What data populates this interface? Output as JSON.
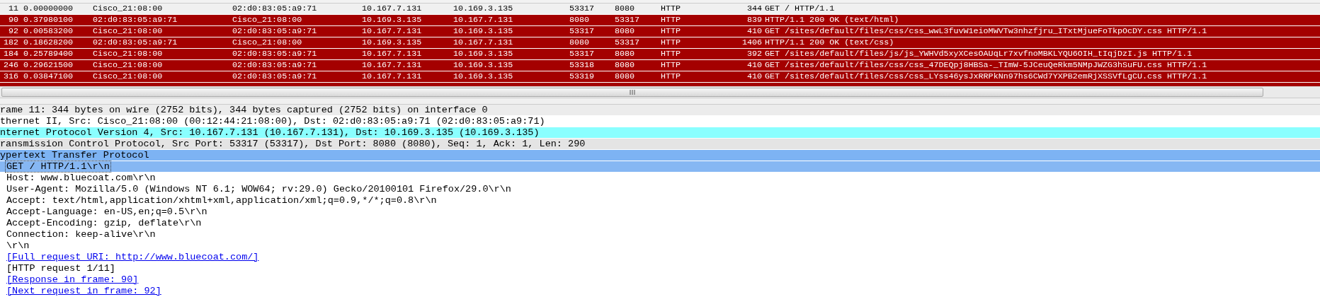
{
  "packets": [
    {
      "no": "11",
      "time": "0.00000000",
      "eth_src": "Cisco_21:08:00",
      "eth_dst": "02:d0:83:05:a9:71",
      "src": "10.167.7.131",
      "dst": "10.169.3.135",
      "src_port": "53317",
      "dst_port": "8080",
      "protocol": "HTTP",
      "length": "344",
      "info": "GET / HTTP/1.1",
      "selected": true
    },
    {
      "no": "90",
      "time": "0.37980100",
      "eth_src": "02:d0:83:05:a9:71",
      "eth_dst": "Cisco_21:08:00",
      "src": "10.169.3.135",
      "dst": "10.167.7.131",
      "src_port": "8080",
      "dst_port": "53317",
      "protocol": "HTTP",
      "length": "839",
      "info": "HTTP/1.1 200 OK  (text/html)",
      "selected": false
    },
    {
      "no": "92",
      "time": "0.00583200",
      "eth_src": "Cisco_21:08:00",
      "eth_dst": "02:d0:83:05:a9:71",
      "src": "10.167.7.131",
      "dst": "10.169.3.135",
      "src_port": "53317",
      "dst_port": "8080",
      "protocol": "HTTP",
      "length": "410",
      "info": "GET /sites/default/files/css/css_wwL3fuvW1eioMWVTw3nhzfjru_ITxtMjueFoTkpOcDY.css HTTP/1.1",
      "selected": false
    },
    {
      "no": "182",
      "time": "0.18628200",
      "eth_src": "02:d0:83:05:a9:71",
      "eth_dst": "Cisco_21:08:00",
      "src": "10.169.3.135",
      "dst": "10.167.7.131",
      "src_port": "8080",
      "dst_port": "53317",
      "protocol": "HTTP",
      "length": "1406",
      "info": "HTTP/1.1 200 OK  (text/css)",
      "selected": false
    },
    {
      "no": "184",
      "time": "0.25789400",
      "eth_src": "Cisco_21:08:00",
      "eth_dst": "02:d0:83:05:a9:71",
      "src": "10.167.7.131",
      "dst": "10.169.3.135",
      "src_port": "53317",
      "dst_port": "8080",
      "protocol": "HTTP",
      "length": "392",
      "info": "GET /sites/default/files/js/js_YWHVd5xyXCesOAUqLr7xvfnoMBKLYQU6OIH_tIqjDzI.js HTTP/1.1",
      "selected": false
    },
    {
      "no": "246",
      "time": "0.29621500",
      "eth_src": "Cisco_21:08:00",
      "eth_dst": "02:d0:83:05:a9:71",
      "src": "10.167.7.131",
      "dst": "10.169.3.135",
      "src_port": "53318",
      "dst_port": "8080",
      "protocol": "HTTP",
      "length": "410",
      "info": "GET /sites/default/files/css/css_47DEQpj8HBSa-_TImW-5JCeuQeRkm5NMpJWZG3hSuFU.css HTTP/1.1",
      "selected": false
    },
    {
      "no": "316",
      "time": "0.03847100",
      "eth_src": "Cisco_21:08:00",
      "eth_dst": "02:d0:83:05:a9:71",
      "src": "10.167.7.131",
      "dst": "10.169.3.135",
      "src_port": "53319",
      "dst_port": "8080",
      "protocol": "HTTP",
      "length": "410",
      "info": "GET /sites/default/files/css/css_LYss46ysJxRRPkNn97hs6CWd7YXPB2emRjXSSVfLgCU.css HTTP/1.1",
      "selected": false
    }
  ],
  "details": [
    {
      "text": "rame 11: 344 bytes on wire (2752 bits), 344 bytes captured (2752 bits) on interface 0",
      "color": "#ececec"
    },
    {
      "text": "thernet II, Src: Cisco_21:08:00 (00:12:44:21:08:00), Dst: 02:d0:83:05:a9:71 (02:d0:83:05:a9:71)",
      "color": "#ffffff"
    },
    {
      "text": "nternet Protocol Version 4, Src: 10.167.7.131 (10.167.7.131), Dst: 10.169.3.135 (10.169.3.135)",
      "color": "#8affff"
    },
    {
      "text": "ransmission Control Protocol, Src Port: 53317 (53317), Dst Port: 8080 (8080), Seq: 1, Ack: 1, Len: 290",
      "color": "#e4e4e4"
    },
    {
      "text": "ypertext Transfer Protocol",
      "color": "#7db3f3",
      "children": [
        {
          "text": "GET / HTTP/1.1\\r\\n",
          "kind": "field",
          "selected": true
        },
        {
          "text": "Host: www.bluecoat.com\\r\\n",
          "kind": "field",
          "selected": false
        },
        {
          "text": "User-Agent: Mozilla/5.0 (Windows NT 6.1; WOW64; rv:29.0) Gecko/20100101 Firefox/29.0\\r\\n",
          "kind": "field",
          "selected": false
        },
        {
          "text": "Accept: text/html,application/xhtml+xml,application/xml;q=0.9,*/*;q=0.8\\r\\n",
          "kind": "field",
          "selected": false
        },
        {
          "text": "Accept-Language: en-US,en;q=0.5\\r\\n",
          "kind": "field",
          "selected": false
        },
        {
          "text": "Accept-Encoding: gzip, deflate\\r\\n",
          "kind": "field",
          "selected": false
        },
        {
          "text": "Connection: keep-alive\\r\\n",
          "kind": "field",
          "selected": false
        },
        {
          "text": "\\r\\n",
          "kind": "field",
          "selected": false
        },
        {
          "text": "[Full request URI: http://www.bluecoat.com/]",
          "kind": "link",
          "selected": false
        },
        {
          "text": "[HTTP request 1/11]",
          "kind": "field",
          "selected": false
        },
        {
          "text": "[Response in frame: 90]",
          "kind": "link",
          "selected": false
        },
        {
          "text": "[Next request in frame: 92]",
          "kind": "link",
          "selected": false
        }
      ]
    }
  ]
}
